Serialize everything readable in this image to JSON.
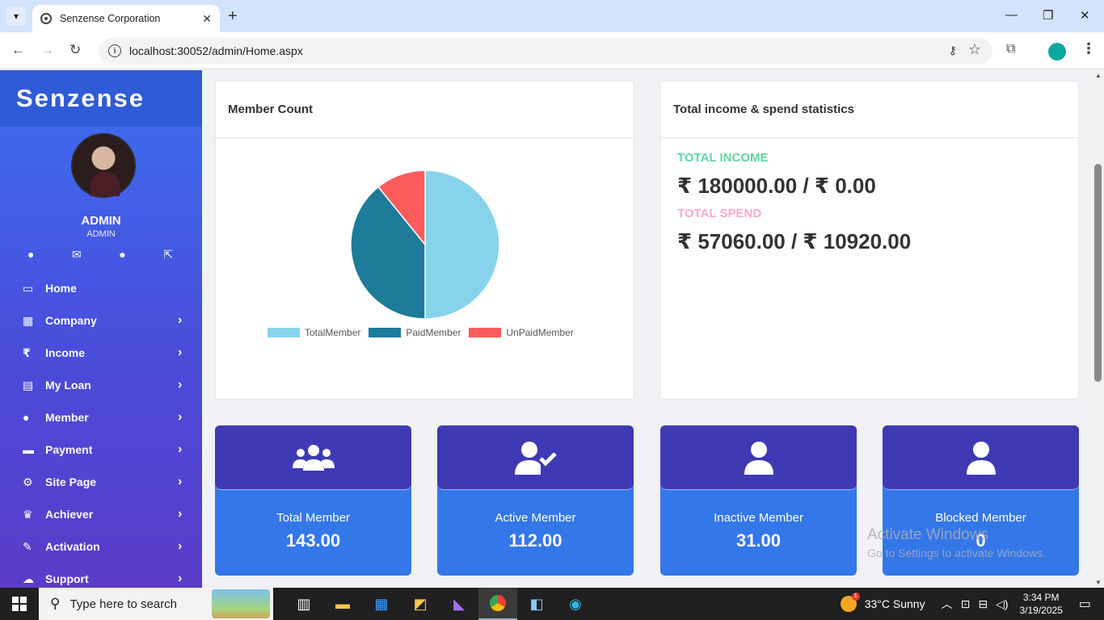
{
  "browser": {
    "tab_title": "Senzense Corporation",
    "url": "localhost:30052/admin/Home.aspx",
    "new_tab_glyph": "+",
    "close_glyph": "✕"
  },
  "sidebar": {
    "brand": "Senzense",
    "user_name": "ADMIN",
    "user_role": "ADMIN",
    "items": [
      {
        "label": "Home",
        "icon": "▭",
        "icon_name": "monitor-icon"
      },
      {
        "label": "Company",
        "icon": "▦",
        "icon_name": "building-icon"
      },
      {
        "label": "Income",
        "icon": "₹",
        "icon_name": "rupee-icon"
      },
      {
        "label": "My Loan",
        "icon": "▤",
        "icon_name": "wallet-icon"
      },
      {
        "label": "Member",
        "icon": "●",
        "icon_name": "user-icon"
      },
      {
        "label": "Payment",
        "icon": "▬",
        "icon_name": "credit-card-icon"
      },
      {
        "label": "Site Page",
        "icon": "⚙",
        "icon_name": "cogs-icon"
      },
      {
        "label": "Achiever",
        "icon": "♛",
        "icon_name": "crown-icon"
      },
      {
        "label": "Activation",
        "icon": "✎",
        "icon_name": "user-edit-icon"
      },
      {
        "label": "Support",
        "icon": "☁",
        "icon_name": "comments-icon"
      }
    ]
  },
  "member_card": {
    "title": "Member Count",
    "legend": [
      "TotalMember",
      "PaidMember",
      "UnPaidMember"
    ]
  },
  "chart_data": {
    "type": "pie",
    "categories": [
      "TotalMember",
      "PaidMember",
      "UnPaidMember"
    ],
    "values": [
      143,
      112,
      31
    ],
    "colors": [
      "#87d3ec",
      "#1e7b9a",
      "#fc5c5c"
    ]
  },
  "income_card": {
    "title": "Total income & spend statistics",
    "income_label": "TOTAL INCOME",
    "income_value": "₹ 180000.00 / ₹ 0.00",
    "spend_label": "TOTAL SPEND",
    "spend_value": "₹ 57060.00 / ₹ 10920.00",
    "income_color": "#5fd6a2",
    "spend_color": "#f7a9d3"
  },
  "stats": [
    {
      "label": "Total Member",
      "value": "143.00",
      "icon": "users-icon"
    },
    {
      "label": "Active Member",
      "value": "112.00",
      "icon": "user-check-icon"
    },
    {
      "label": "Inactive Member",
      "value": "31.00",
      "icon": "user-icon"
    },
    {
      "label": "Blocked Member",
      "value": "0",
      "icon": "user-icon"
    }
  ],
  "watermark": {
    "line1": "Activate Windows",
    "line2": "Go to Settings to activate Windows."
  },
  "taskbar": {
    "search_placeholder": "Type here to search",
    "weather": "33°C  Sunny",
    "time": "3:34 PM",
    "date": "3/19/2025"
  }
}
